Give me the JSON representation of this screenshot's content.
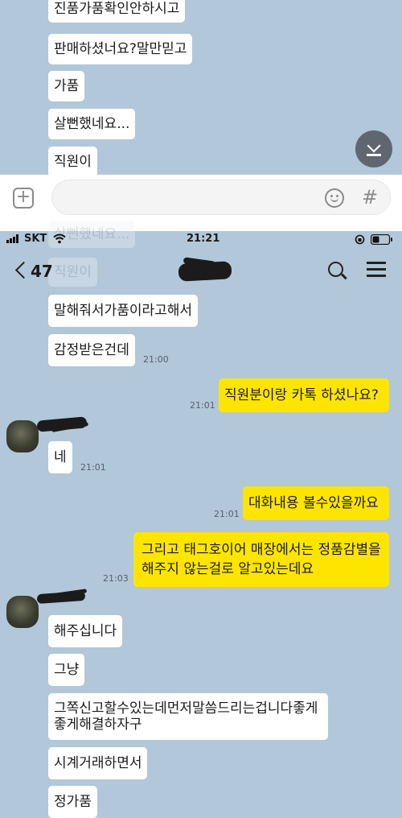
{
  "chat_top": {
    "messages": [
      {
        "text": "진품가품확인안하시고"
      },
      {
        "text": "판매하셨너요?말만믿고"
      },
      {
        "text": "가품"
      },
      {
        "text": "살뻔했네요..."
      },
      {
        "text": "직원이"
      }
    ]
  },
  "input_bar": {
    "placeholder": "",
    "hash_label": "#"
  },
  "status_bar": {
    "carrier": "SKT",
    "time": "21:21"
  },
  "header": {
    "back_count": "47"
  },
  "ghost": {
    "line1": "살뻔했네요...",
    "line2": "직원이"
  },
  "chat": {
    "m1": {
      "text": "말해줘서가품이라고해서"
    },
    "m2": {
      "text": "감정받은건데",
      "time": "21:00"
    },
    "m3": {
      "text": "직원분이랑 카톡 하셨나요?",
      "time": "21:01"
    },
    "m4": {
      "text": "네",
      "time": "21:01"
    },
    "m5": {
      "text": "대화내용 볼수있을까요",
      "time": "21:01"
    },
    "m6": {
      "text": "그리고 태그호이어 매장에서는 정품감별을 해주지 않는걸로 알고있는데요",
      "time": "21:03"
    },
    "m7": {
      "text": "해주십니다"
    },
    "m8": {
      "text": "그냥"
    },
    "m9": {
      "text": "그쪽신고할수있는데먼저말씀드리는겁니다좋게 좋게해결하자구"
    },
    "m10": {
      "text": "시계거래하면서"
    },
    "m11": {
      "text": "정가품"
    }
  },
  "colors": {
    "chat_bg": "#b2c7d9",
    "my_bubble": "#fee500",
    "their_bubble": "#ffffff"
  }
}
